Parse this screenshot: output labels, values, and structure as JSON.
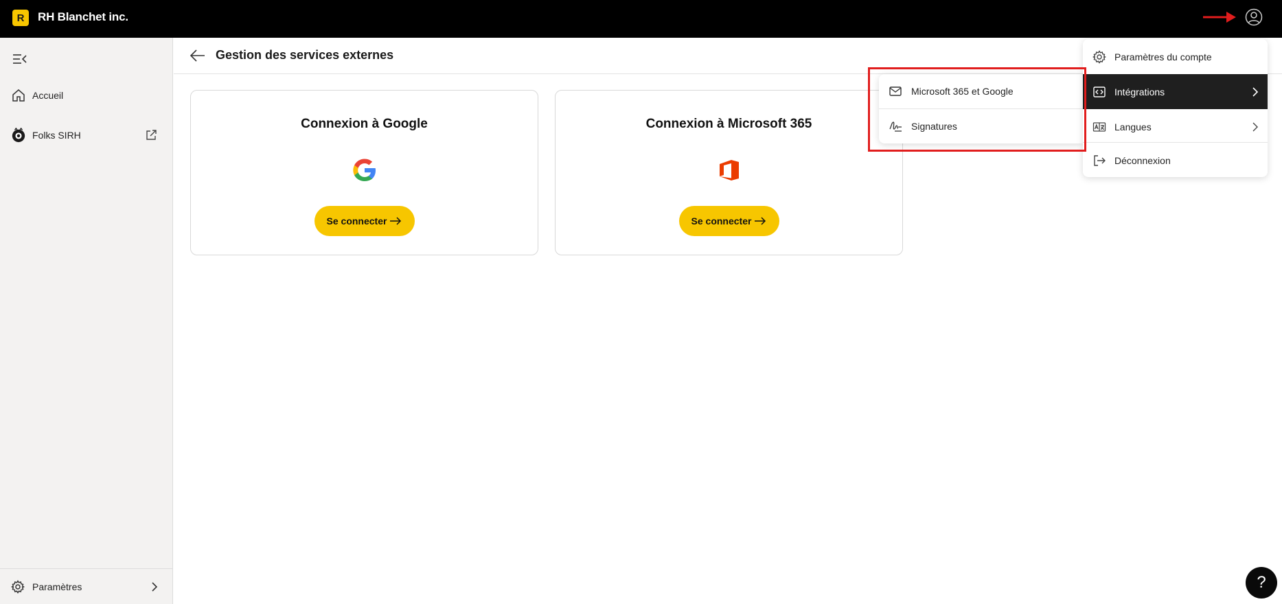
{
  "topbar": {
    "brand_initial": "R",
    "brand_name": "RH Blanchet inc.",
    "brand_color": "#f7c600",
    "user_icon": "user-circle-icon",
    "annotation_arrow_color": "#e11d1d"
  },
  "sidebar": {
    "collapse_icon": "collapse-menu-icon",
    "items": [
      {
        "label": "Accueil",
        "icon": "home-icon"
      },
      {
        "label": "Folks SIRH",
        "icon": "folks-logo-icon",
        "external_icon": "external-link-icon"
      }
    ],
    "bottom": {
      "label": "Paramètres",
      "icon": "gear-icon",
      "chevron": "chevron-right-icon"
    }
  },
  "header": {
    "back_icon": "back-arrow-icon",
    "title": "Gestion des services externes"
  },
  "cards": [
    {
      "title": "Connexion à Google",
      "logo": "google-logo",
      "button_label": "Se connecter"
    },
    {
      "title": "Connexion à Microsoft 365",
      "logo": "office-logo",
      "button_label": "Se connecter"
    }
  ],
  "account_menu": {
    "items": [
      {
        "label": "Paramètres du compte",
        "icon": "gear-icon"
      },
      {
        "label": "Intégrations",
        "icon": "code-icon",
        "active": true,
        "chevron": "chevron-right-icon"
      },
      {
        "label": "Langues",
        "icon": "language-icon",
        "chevron": "chevron-right-icon"
      },
      {
        "label": "Déconnexion",
        "icon": "logout-icon"
      }
    ]
  },
  "integrations_submenu": {
    "items": [
      {
        "label": "Microsoft 365 et Google",
        "icon": "mail-icon"
      },
      {
        "label": "Signatures",
        "icon": "signature-icon"
      }
    ]
  },
  "help": {
    "label": "?"
  }
}
